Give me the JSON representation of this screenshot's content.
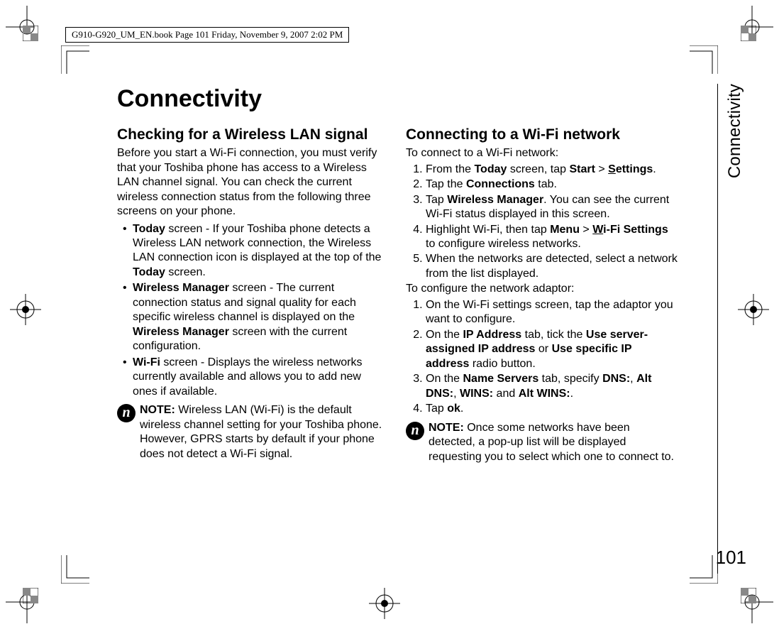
{
  "header": "G910-G920_UM_EN.book  Page 101  Friday, November 9, 2007  2:02 PM",
  "title": "Connectivity",
  "side_label": "Connectivity",
  "page_number": "101",
  "left": {
    "heading": "Checking for a Wireless LAN signal",
    "intro": "Before you start a Wi-Fi connection, you must verify that your Toshiba phone has access to a Wireless LAN channel signal. You can check the current wireless connection status from the following three screens on your phone.",
    "b1_a": "Today",
    "b1_b": " screen - If your Toshiba phone detects a Wireless LAN network connection, the Wireless LAN connection icon is displayed at the top of the ",
    "b1_c": "Today",
    "b1_d": " screen.",
    "b2_a": "Wireless Manager",
    "b2_b": " screen - The current connection status and signal quality for each specific wireless channel is displayed on the ",
    "b2_c": "Wireless Manager",
    "b2_d": " screen with the current configuration.",
    "b3_a": "Wi-Fi",
    "b3_b": " screen - Displays the wireless networks currently available and allows you to add new ones if available.",
    "note_label": "NOTE:",
    "note_text": " Wireless LAN (Wi-Fi) is the default wireless channel setting for your Toshiba phone. However, GPRS starts by default if your phone does not detect a Wi-Fi signal."
  },
  "right": {
    "heading": "Connecting to a Wi-Fi network",
    "intro1": "To connect to a Wi-Fi network:",
    "s1_a": "From the ",
    "s1_b": "Today",
    "s1_c": " screen, tap ",
    "s1_d": "Start",
    "s1_e": " > ",
    "s1_f": "S",
    "s1_g": "ettings",
    "s1_h": ".",
    "s2_a": "Tap the ",
    "s2_b": "Connections",
    "s2_c": " tab.",
    "s3_a": "Tap ",
    "s3_b": "Wireless Manager",
    "s3_c": ". You can see the current Wi-Fi status displayed in this screen.",
    "s4_a": "Highlight Wi-Fi, then tap ",
    "s4_b": "Menu",
    "s4_c": " > ",
    "s4_d": "W",
    "s4_e": "i-Fi Settings",
    "s4_f": " to configure wireless networks.",
    "s5": "When the networks are detected, select a network from the list displayed.",
    "intro2": "To configure the network adaptor:",
    "t1": "On the Wi-Fi settings screen, tap the adaptor you want to configure.",
    "t2_a": "On the ",
    "t2_b": "IP Address",
    "t2_c": " tab, tick the ",
    "t2_d": "Use server-assigned IP address",
    "t2_e": " or ",
    "t2_f": "Use specific IP address",
    "t2_g": " radio button.",
    "t3_a": "On the ",
    "t3_b": "Name Servers",
    "t3_c": " tab, specify ",
    "t3_d": "DNS:",
    "t3_e": ", ",
    "t3_f": "Alt DNS:",
    "t3_g": ", ",
    "t3_h": "WINS:",
    "t3_i": " and ",
    "t3_j": "Alt WINS:",
    "t3_k": ".",
    "t4_a": "Tap ",
    "t4_b": "ok",
    "t4_c": ".",
    "note_label": "NOTE:",
    "note_text": " Once some networks have been detected, a pop-up list will be displayed requesting you to select which one to connect to."
  },
  "note_glyph": "n"
}
